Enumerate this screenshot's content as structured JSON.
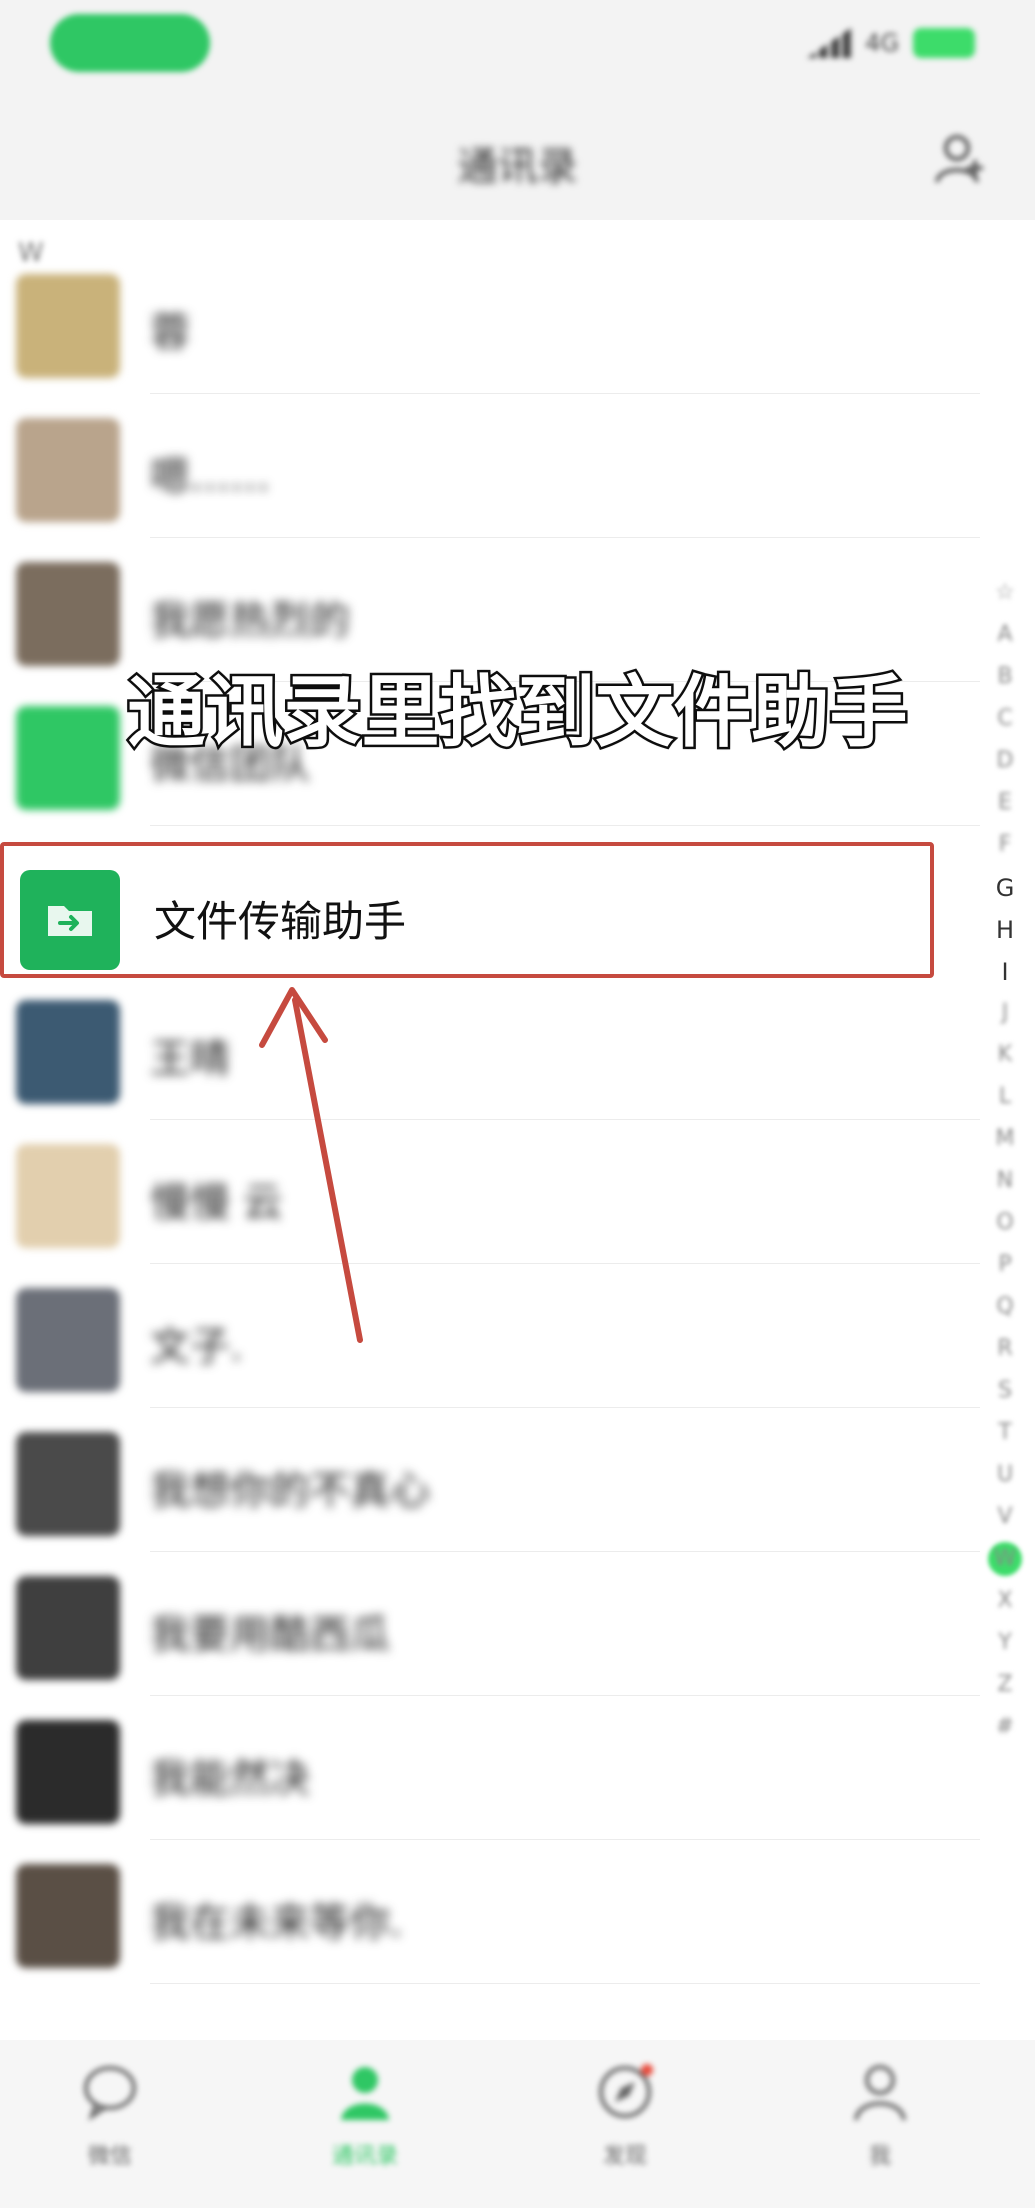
{
  "status_bar": {
    "network": "4G"
  },
  "nav": {
    "title": "通讯录"
  },
  "section": {
    "letter": "W"
  },
  "contacts": [
    {
      "name": "蓉",
      "avatar_color": "#c9b27a"
    },
    {
      "name": "嗯……",
      "avatar_color": "#b9a48c"
    },
    {
      "name": "我愿热烈的",
      "avatar_color": "#7b6d5e"
    },
    {
      "name": "微信团队",
      "avatar_color": "#2fc764"
    },
    {
      "name": "王晴",
      "avatar_color": "#3c5a72"
    },
    {
      "name": "慢慢 云",
      "avatar_color": "#e2cfae"
    },
    {
      "name": "文子.",
      "avatar_color": "#6b6f78"
    },
    {
      "name": "我想你的不真心",
      "avatar_color": "#4a4a4a"
    },
    {
      "name": "我要用酷西瓜",
      "avatar_color": "#3f3f3f"
    },
    {
      "name": "我能然决",
      "avatar_color": "#2b2b2b"
    },
    {
      "name": "我在未来等你.",
      "avatar_color": "#5a4f45"
    }
  ],
  "highlight": {
    "name": "文件传输助手",
    "icon": "file-transfer-icon",
    "border_color": "#c64a3f",
    "icon_color": "#1fb25b"
  },
  "caption": "通讯录里找到文件助手",
  "index_letters": {
    "blurred_top": [
      "☆",
      "A",
      "B",
      "C",
      "D",
      "E",
      "F"
    ],
    "sharp": [
      "G",
      "H",
      "I"
    ],
    "blurred_bottom": [
      "J",
      "K",
      "L",
      "M",
      "N",
      "O",
      "P",
      "Q",
      "R",
      "S",
      "T",
      "U",
      "V",
      "W",
      "X",
      "Y",
      "Z",
      "#"
    ]
  },
  "tabs": [
    {
      "label": "微信",
      "icon": "chat-icon",
      "active": false
    },
    {
      "label": "通讯录",
      "icon": "contacts-icon",
      "active": true
    },
    {
      "label": "发现",
      "icon": "compass-icon",
      "active": false
    },
    {
      "label": "我",
      "icon": "me-icon",
      "active": false
    }
  ],
  "colors": {
    "accent": "#2fc764",
    "arrow": "#c64a3f"
  }
}
